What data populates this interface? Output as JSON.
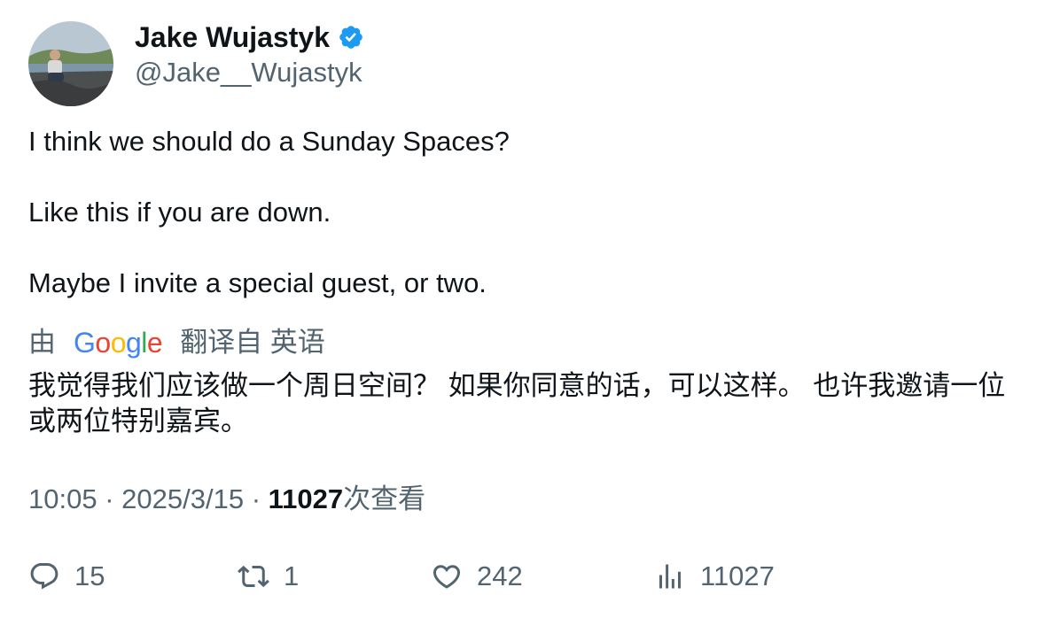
{
  "author": {
    "display_name": "Jake Wujastyk",
    "handle": "@Jake__Wujastyk",
    "verified_icon": "verified-badge-icon",
    "accent_color": "#1d9bf0"
  },
  "tweet": {
    "paragraphs": [
      "I think we should do a Sunday Spaces?",
      "Like this if you are down.",
      "Maybe I invite a special guest, or two."
    ]
  },
  "translation": {
    "prefix": "由",
    "provider": "Google",
    "suffix": "翻译自 英语",
    "text": "我觉得我们应该做一个周日空间？ 如果你同意的话，可以这样。 也许我邀请一位或两位特别嘉宾。"
  },
  "meta": {
    "time": "10:05",
    "separator": "·",
    "date": "2025/3/15",
    "views_count": "11027",
    "views_label": "次查看"
  },
  "actions": {
    "replies": {
      "icon": "reply-icon",
      "count": "15"
    },
    "retweets": {
      "icon": "retweet-icon",
      "count": "1"
    },
    "likes": {
      "icon": "heart-icon",
      "count": "242"
    },
    "views": {
      "icon": "analytics-icon",
      "count": "11027"
    }
  }
}
